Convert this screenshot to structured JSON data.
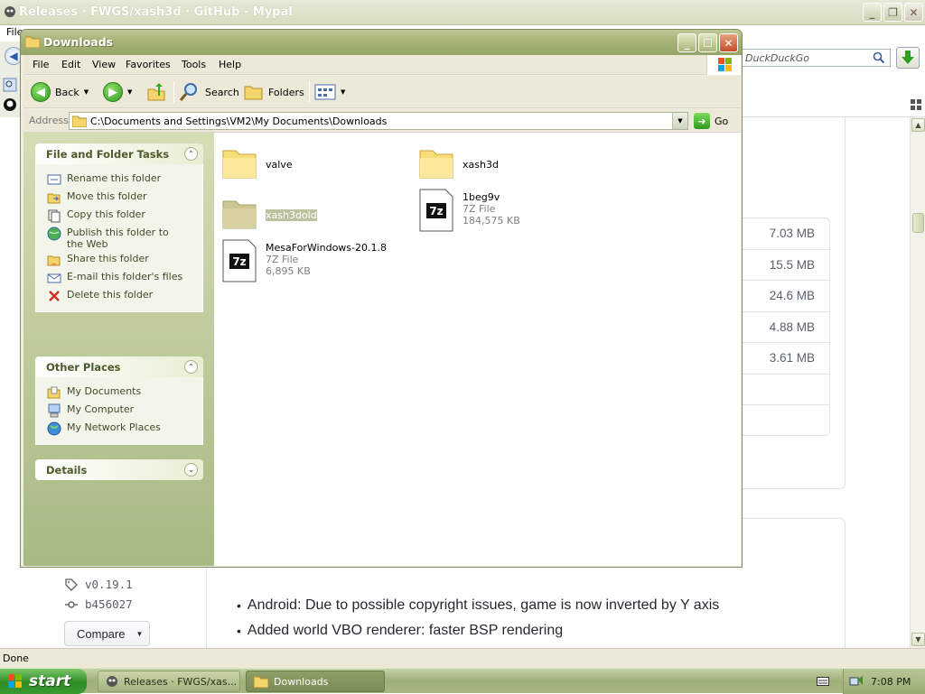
{
  "browser": {
    "title": "Releases · FWGS/xash3d · GitHub - Mypal",
    "menu_first": "File",
    "search_placeholder": "DuckDuckGo",
    "status": "Done",
    "assets": [
      "7.03 MB",
      "15.5 MB",
      "24.6 MB",
      "4.88 MB",
      "3.61 MB"
    ],
    "release": {
      "tag": "v0.19.1",
      "commit": "b456027",
      "compare_label": "Compare",
      "notes": [
        "Android: Due to possible copyright issues, game is now inverted by Y axis",
        "Added world VBO renderer: faster BSP rendering"
      ]
    }
  },
  "explorer": {
    "title": "Downloads",
    "menu": [
      "File",
      "Edit",
      "View",
      "Favorites",
      "Tools",
      "Help"
    ],
    "toolbar": {
      "back": "Back",
      "search": "Search",
      "folders": "Folders"
    },
    "address": {
      "label": "Address",
      "path": "C:\\Documents and Settings\\VM2\\My Documents\\Downloads",
      "go": "Go"
    },
    "tasks": {
      "file_folder_title": "File and Folder Tasks",
      "file_folder_items": [
        "Rename this folder",
        "Move this folder",
        "Copy this folder",
        "Publish this folder to the Web",
        "Share this folder",
        "E-mail this folder's files",
        "Delete this folder"
      ],
      "other_places_title": "Other Places",
      "other_places_items": [
        "My Documents",
        "My Computer",
        "My Network Places"
      ],
      "details_title": "Details"
    },
    "files": [
      {
        "name": "valve",
        "kind": "folder"
      },
      {
        "name": "xash3d",
        "kind": "folder"
      },
      {
        "name": "xash3dold",
        "kind": "folder",
        "selected": true
      },
      {
        "name": "1beg9v",
        "kind": "7z",
        "type": "7Z File",
        "size": "184,575 KB"
      },
      {
        "name": "MesaForWindows-20.1.8",
        "kind": "7z",
        "type": "7Z File",
        "size": "6,895 KB"
      }
    ]
  },
  "taskbar": {
    "start": "start",
    "tasks": [
      "Releases · FWGS/xas...",
      "Downloads"
    ],
    "clock": "7:08 PM"
  },
  "icons": {
    "folder": "folder-icon",
    "archive": "7z-archive-icon",
    "back": "back-arrow-icon",
    "forward": "forward-arrow-icon"
  },
  "colors": {
    "xp_olive_title": "#a7b47a",
    "taskpane": "#d5ddb4",
    "start_green": "#2e8b25",
    "close_red": "#c2502b"
  }
}
